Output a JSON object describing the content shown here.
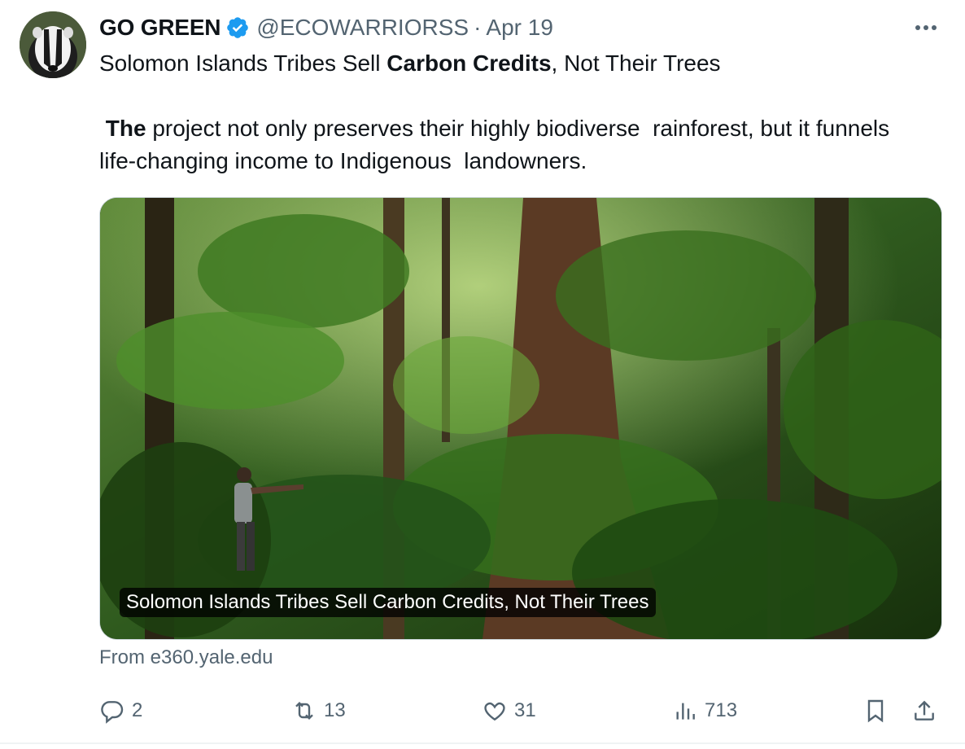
{
  "tweet": {
    "author_name": "GO GREEN",
    "handle": "@ECOWARRIORSS",
    "separator": "·",
    "date": "Apr 19",
    "line1": {
      "pre": "Solomon Islands Tribes Sell ",
      "bold": "Carbon Credits",
      "post": ", Not Their Trees"
    },
    "paragraph": {
      "bold": "The",
      "rest": " project not only preserves their highly biodiverse  rainforest, but it funnels life-changing income to Indigenous  landowners."
    }
  },
  "card": {
    "caption": "Solomon Islands Tribes Sell Carbon Credits, Not Their Trees",
    "source": "From e360.yale.edu"
  },
  "actions": {
    "replies": "2",
    "reposts": "13",
    "likes": "31",
    "views": "713"
  },
  "icons": [
    "verified-badge-icon",
    "more-icon",
    "reply-icon",
    "repost-icon",
    "like-icon",
    "views-icon",
    "bookmark-icon",
    "share-icon"
  ],
  "colors": {
    "verified": "#1d9bf0",
    "secondary_text": "#536471",
    "primary_text": "#0f1419"
  }
}
